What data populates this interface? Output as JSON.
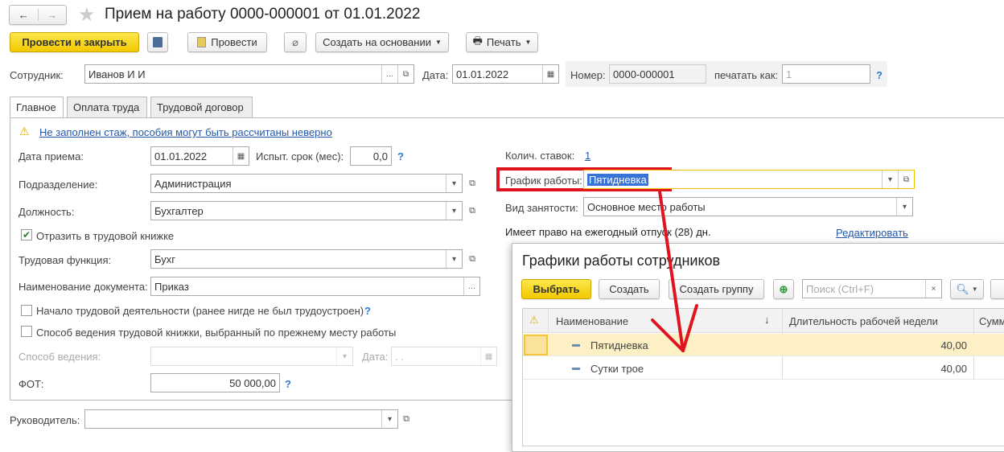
{
  "nav": {
    "back": "←",
    "forward": "→",
    "star": "★"
  },
  "title": "Прием на работу 0000-000001 от 01.01.2022",
  "toolbar": {
    "post_close": "Провести и закрыть",
    "post": "Провести",
    "create_based": "Создать на основании",
    "print": "Печать"
  },
  "header": {
    "employee_label": "Сотрудник:",
    "employee": "Иванов И И",
    "date_label": "Дата:",
    "date": "01.01.2022",
    "number_label": "Номер:",
    "number": "0000-000001",
    "print_as_label": "печатать как:",
    "print_as": "1",
    "help": "?"
  },
  "tabs": [
    "Главное",
    "Оплата труда",
    "Трудовой договор"
  ],
  "main": {
    "warning": "Не заполнен стаж, пособия могут быть рассчитаны неверно",
    "hire_date_label": "Дата приема:",
    "hire_date": "01.01.2022",
    "probation_label": "Испыт. срок (мес):",
    "probation": "0,0",
    "department_label": "Подразделение:",
    "department": "Администрация",
    "position_label": "Должность:",
    "position": "Бухгалтер",
    "record_label": "Отразить в трудовой книжке",
    "function_label": "Трудовая функция:",
    "function": "Бухг",
    "docname_label": "Наименование документа:",
    "docname": "Приказ",
    "start_label": "Начало трудовой деятельности (ранее нигде не был трудоустроен)",
    "method_label": "Способ ведения трудовой книжки, выбранный по прежнему месту работы",
    "method_field_label": "Способ ведения:",
    "method_date_label": "Дата:",
    "method_date": " .  .",
    "fot_label": "ФОТ:",
    "fot": "50 000,00",
    "rates_label": "Колич. ставок:",
    "rates": "1",
    "schedule_label": "График работы:",
    "schedule": "Пятидневка",
    "employment_label": "Вид занятости:",
    "employment": "Основное место работы",
    "vacation": "Имеет право на ежегодный отпуск (28) дн.",
    "edit": "Редактировать",
    "manager_label": "Руководитель:"
  },
  "popup": {
    "title": "Графики работы сотрудников",
    "select": "Выбрать",
    "create": "Создать",
    "create_group": "Создать группу",
    "search_placeholder": "Поиск (Ctrl+F)",
    "clear": "×",
    "columns": [
      "Наименование",
      "Длительность рабочей недели",
      "Сумм"
    ],
    "rows": [
      {
        "name": "Пятидневка",
        "hours": "40,00"
      },
      {
        "name": "Сутки трое",
        "hours": "40,00"
      }
    ]
  }
}
